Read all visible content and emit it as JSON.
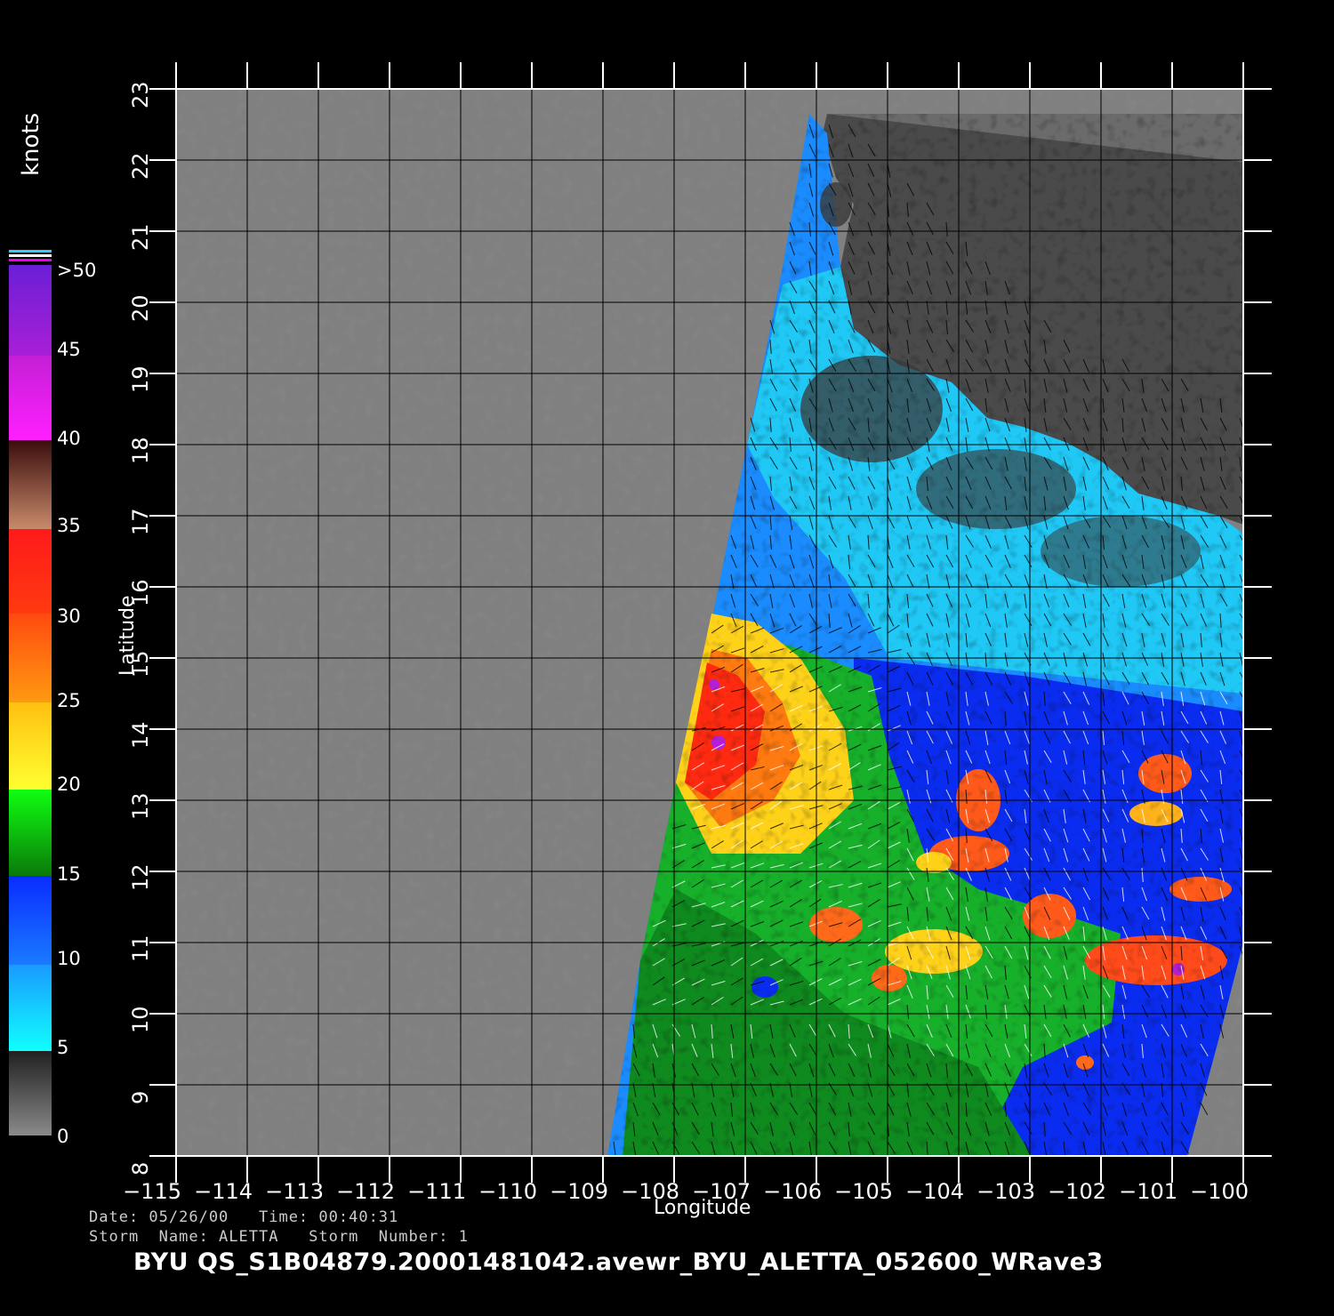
{
  "legend": {
    "unit": "knots",
    "labels": [
      ">50",
      "45",
      "40",
      "35",
      "30",
      "25",
      "20",
      "15",
      "10",
      "5",
      "0"
    ]
  },
  "axes": {
    "xlabel": "Longitude",
    "ylabel": "Latitude",
    "lon_ticks": [
      "−115",
      "−114",
      "−113",
      "−112",
      "−111",
      "−110",
      "−109",
      "−108",
      "−107",
      "−106",
      "−105",
      "−104",
      "−103",
      "−102",
      "−101",
      "−100"
    ],
    "lat_ticks": [
      "23",
      "22",
      "21",
      "20",
      "19",
      "18",
      "17",
      "16",
      "15",
      "14",
      "13",
      "12",
      "11",
      "10",
      "9",
      "8"
    ]
  },
  "info": {
    "line1": "Date: 05/26/00   Time: 00:40:31",
    "line2": "Storm  Name: ALETTA   Storm  Number: 1"
  },
  "title": "BYU  QS_S1B04879.20001481042.avewr_BYU_ALETTA_052600_WRave3",
  "colors": {
    "background": "#000000",
    "no_data": "#808080",
    "land": "#4a4a4a",
    "grid": "#000000",
    "frame": "#ffffff"
  }
}
